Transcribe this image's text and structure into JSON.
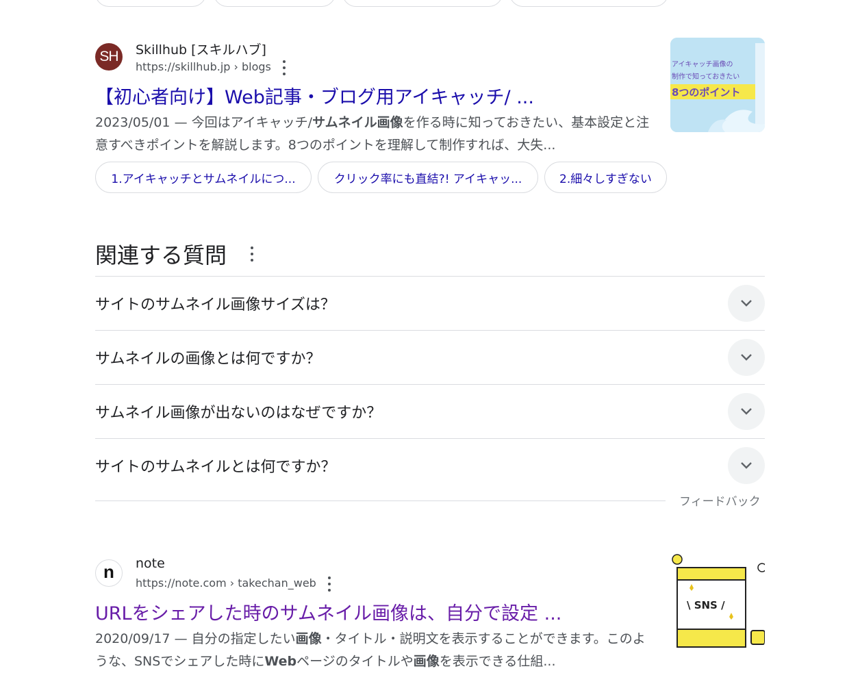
{
  "result1": {
    "favicon_text": "SH",
    "favicon_bg": "#7b2a26",
    "site_name": "Skillhub [スキルハブ]",
    "url": "https://skillhub.jp › blogs",
    "title": "【初心者向け】Web記事・ブログ用アイキャッチ/ ...",
    "snippet_date": "2023/05/01",
    "snippet_parts": [
      "— 今回はアイキャッチ/",
      "サムネイル画像",
      "を作る時に知っておきたい、基本設定と注意すべきポイントを解説します。8つのポイントを理解して制作すれば、大失..."
    ],
    "thumbnail": {
      "line1": "アイキャッチ画像の",
      "line2": "制作で知っておきたい",
      "line3": "8つのポイント"
    },
    "sitelinks": [
      "1.アイキャッチとサムネイルにつ...",
      "クリック率にも直結?! アイキャッ...",
      "2.細々しすぎない"
    ]
  },
  "paa": {
    "heading": "関連する質問",
    "questions": [
      "サイトのサムネイル画像サイズは？",
      "サムネイルの画像とは何ですか？",
      "サムネイル画像が出ないのはなぜですか？",
      "サイトのサムネイルとは何ですか？"
    ],
    "feedback": "フィードバック"
  },
  "result2": {
    "favicon_text": "n",
    "site_name": "note",
    "url": "https://note.com › takechan_web",
    "title": "URLをシェアした時のサムネイル画像は、自分で設定 ...",
    "snippet_date": "2020/09/17",
    "snippet_parts": [
      "— 自分の指定したい",
      "画像",
      "・タイトル・説明文を表示することができます。このような、SNSでシェアした時に",
      "Web",
      "ページのタイトルや",
      "画像",
      "を表示できる仕組..."
    ],
    "thumbnail": {
      "label": "\\ SNS /"
    }
  },
  "colors": {
    "link_blue": "#1a0dab",
    "link_visited": "#681da8",
    "snippet_gray": "#4d5156"
  }
}
